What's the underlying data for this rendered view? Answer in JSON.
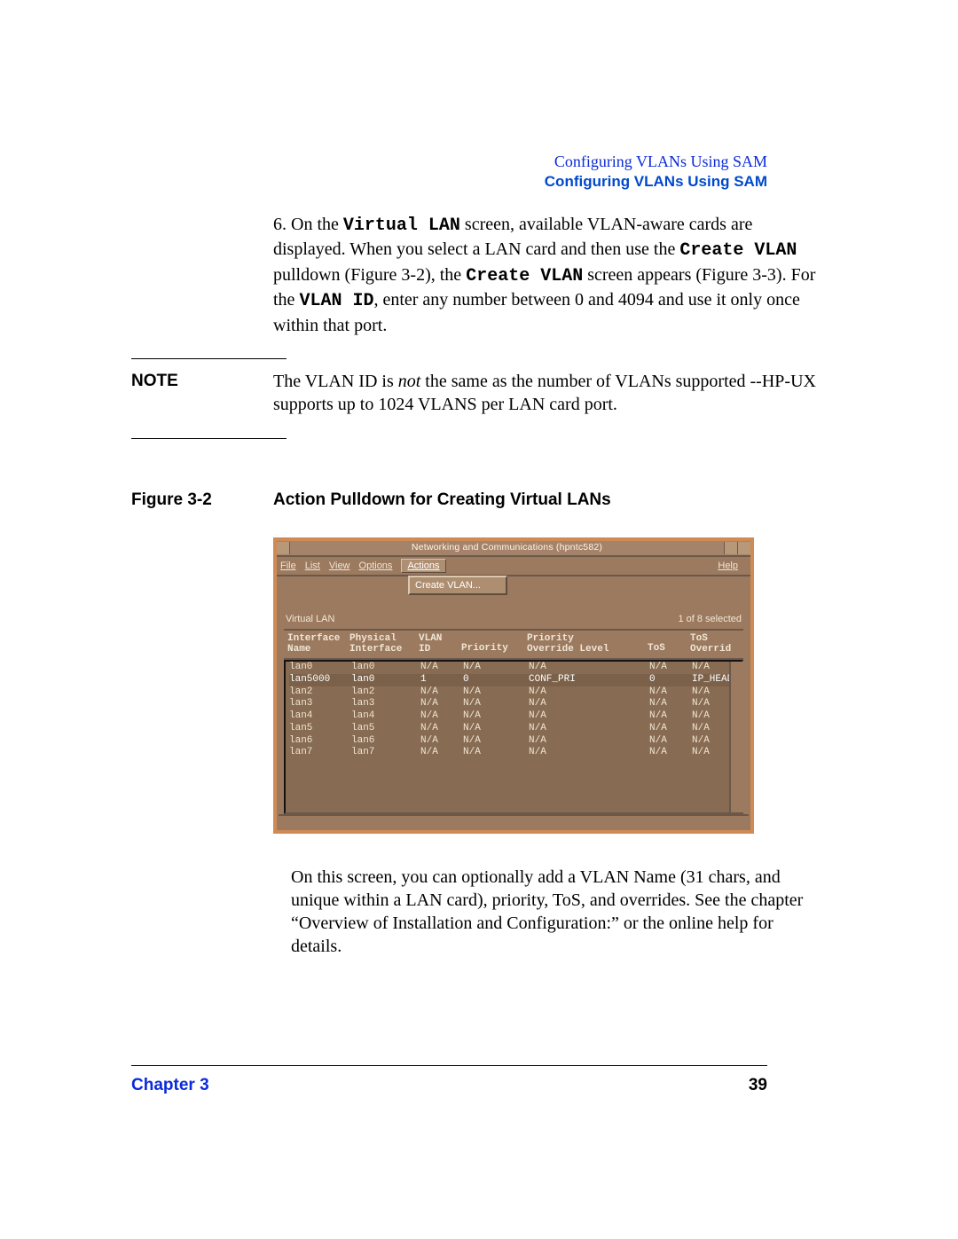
{
  "header": {
    "line1": "Configuring VLANs Using SAM",
    "line2": "Configuring VLANs Using SAM"
  },
  "step": {
    "number": "6.",
    "text_a": "On the ",
    "mono_a": "Virtual LAN",
    "text_b": " screen, available VLAN-aware cards are displayed. When you select a LAN card and then use the ",
    "mono_b": "Create VLAN",
    "text_c": " pulldown (Figure 3-2), the ",
    "mono_c": "Create VLAN",
    "text_d": " screen appears (Figure 3-3). For the ",
    "mono_d": "VLAN ID",
    "text_e": ", enter any number between 0 and 4094 and use it only once within that port."
  },
  "note": {
    "label": "NOTE",
    "body_a": "The VLAN ID is ",
    "body_italic": "not",
    "body_b": " the same as the number of VLANs supported --HP-UX supports up to 1024 VLANS per LAN card port."
  },
  "figure": {
    "label": "Figure 3-2",
    "title": "Action Pulldown for Creating Virtual LANs"
  },
  "sam": {
    "title": "Networking and Communications (hpntc582)",
    "menu": {
      "file": "File",
      "list": "List",
      "view": "View",
      "options": "Options",
      "actions": "Actions",
      "help": "Help"
    },
    "dropdown_item": "Create VLAN...",
    "section_label": "Virtual LAN",
    "selection_text": "1 of 8 selected",
    "columns": {
      "iface_name": "Interface\nName",
      "phys_iface": "Physical\nInterface",
      "vlan_id": "VLAN\nID",
      "priority": "Priority",
      "pri_override": "Priority\nOverride Level",
      "tos": "ToS",
      "tos_override": "ToS\nOverrid"
    },
    "rows": [
      {
        "iface": "lan0",
        "phys": "lan0",
        "vlan": "N/A",
        "pri": "N/A",
        "pol": "N/A",
        "tos": "N/A",
        "tosov": "N/A"
      },
      {
        "iface": "lan5000",
        "phys": "lan0",
        "vlan": "1",
        "pri": "0",
        "pol": "CONF_PRI",
        "tos": "0",
        "tosov": "IP_HEADE",
        "selected": true
      },
      {
        "iface": "lan2",
        "phys": "lan2",
        "vlan": "N/A",
        "pri": "N/A",
        "pol": "N/A",
        "tos": "N/A",
        "tosov": "N/A"
      },
      {
        "iface": "lan3",
        "phys": "lan3",
        "vlan": "N/A",
        "pri": "N/A",
        "pol": "N/A",
        "tos": "N/A",
        "tosov": "N/A"
      },
      {
        "iface": "lan4",
        "phys": "lan4",
        "vlan": "N/A",
        "pri": "N/A",
        "pol": "N/A",
        "tos": "N/A",
        "tosov": "N/A"
      },
      {
        "iface": "lan5",
        "phys": "lan5",
        "vlan": "N/A",
        "pri": "N/A",
        "pol": "N/A",
        "tos": "N/A",
        "tosov": "N/A"
      },
      {
        "iface": "lan6",
        "phys": "lan6",
        "vlan": "N/A",
        "pri": "N/A",
        "pol": "N/A",
        "tos": "N/A",
        "tosov": "N/A"
      },
      {
        "iface": "lan7",
        "phys": "lan7",
        "vlan": "N/A",
        "pri": "N/A",
        "pol": "N/A",
        "tos": "N/A",
        "tosov": "N/A"
      }
    ]
  },
  "after_figure": "On this screen, you can optionally add a VLAN Name (31 chars, and unique within a LAN card), priority, ToS, and overrides. See the chapter “Overview of Installation and Configuration:” or the online help for details.",
  "footer": {
    "chapter": "Chapter 3",
    "page": "39"
  }
}
